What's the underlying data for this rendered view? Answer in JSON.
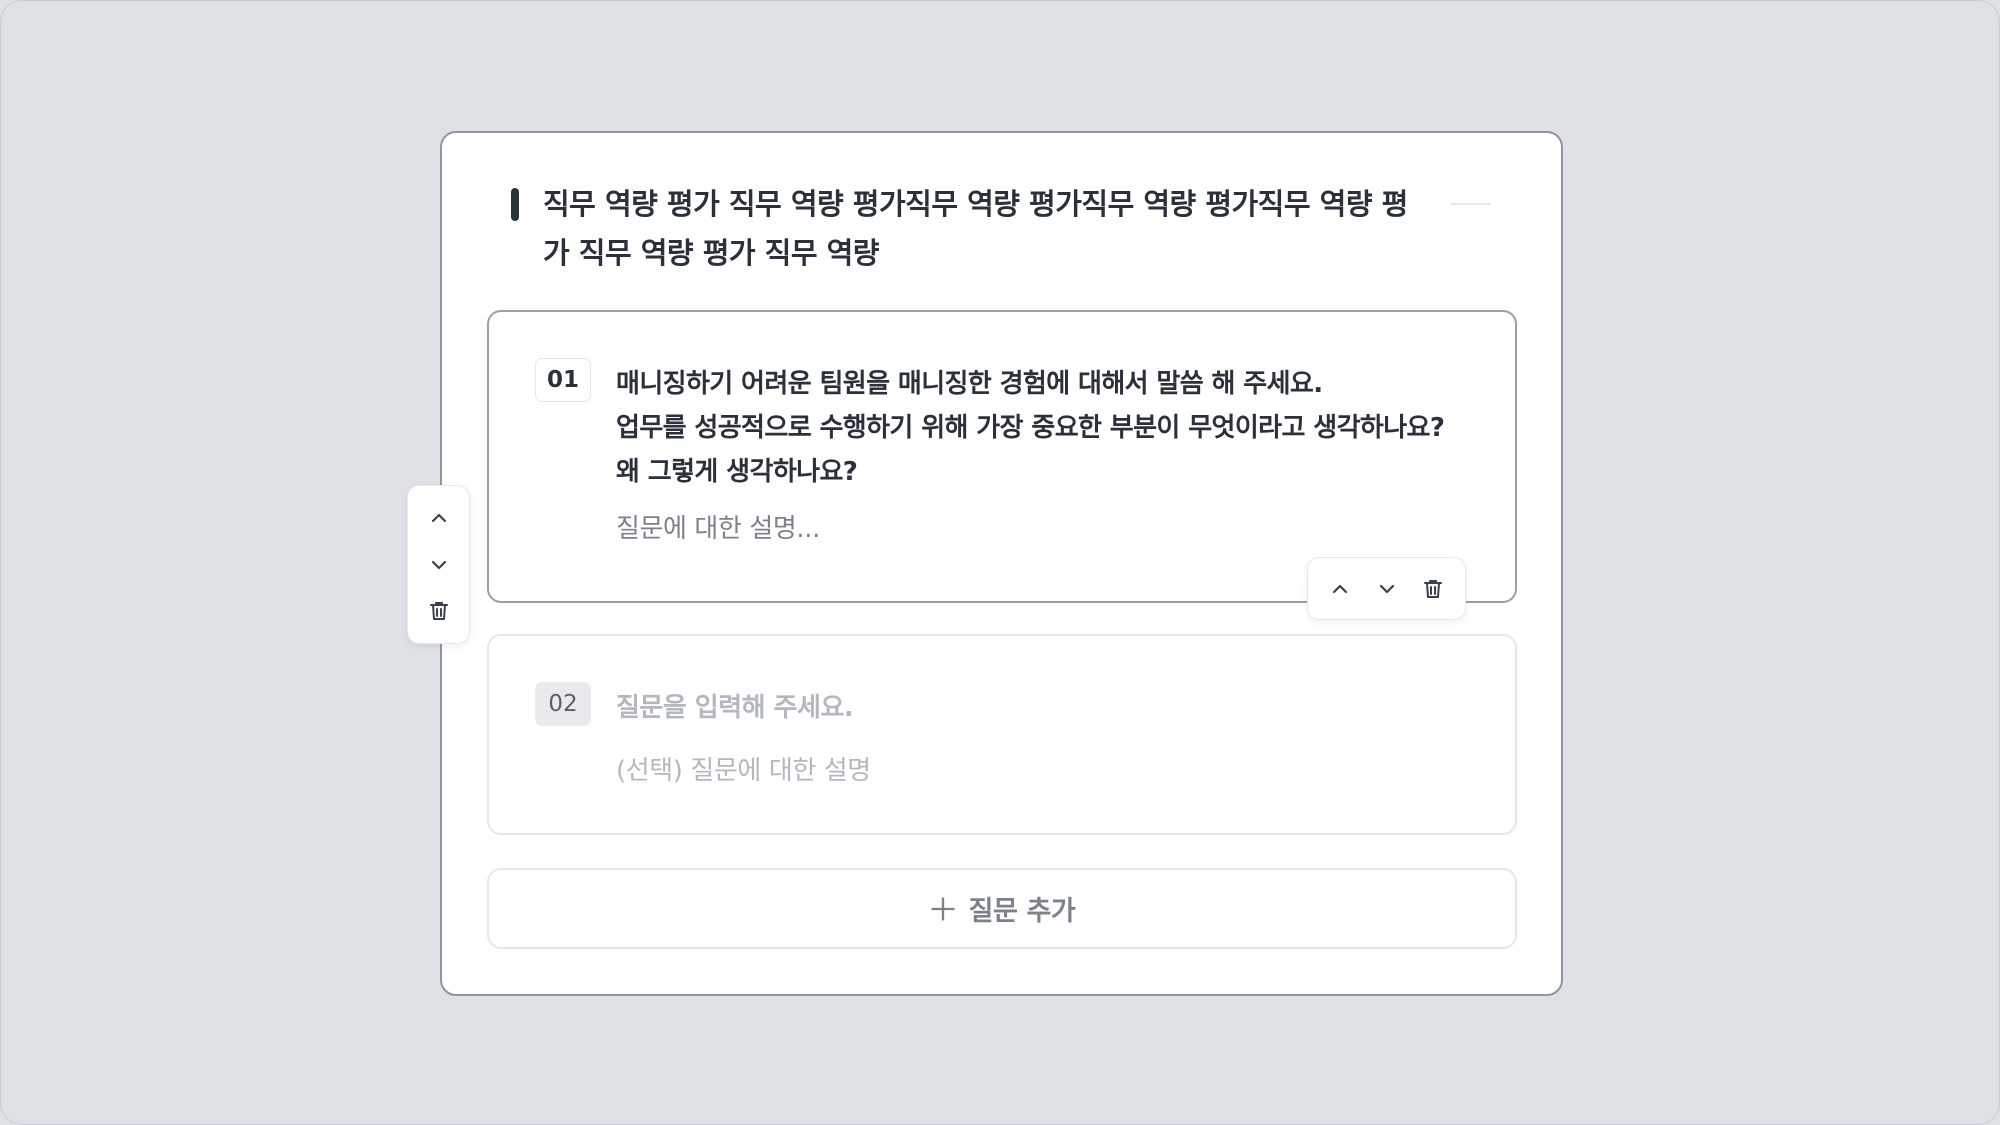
{
  "section": {
    "title": "직무 역량 평가 직무 역량 평가직무 역량 평가직무 역량 평가직무 역량 평가 직무 역량 평가 직무 역량"
  },
  "questions": [
    {
      "number": "01",
      "lines": [
        "매니징하기 어려운 팀원을 매니징한 경험에 대해서 말씀 해 주세요.",
        "업무를 성공적으로 수행하기 위해 가장 중요한 부분이 무엇이라고 생각하나요?",
        "왜 그렇게 생각하나요?"
      ],
      "description": "질문에 대한 설명..."
    },
    {
      "number": "02",
      "placeholder": "질문을 입력해 주세요.",
      "description_placeholder": "(선택) 질문에 대한 설명"
    }
  ],
  "toolbar": {
    "icons": [
      "chevron-up-icon",
      "chevron-down-icon",
      "trash-icon"
    ]
  },
  "add_question": {
    "label": "질문 추가",
    "icon": "plus-icon"
  },
  "colors": {
    "background": "#dee1e6",
    "text_primary": "#2b313b",
    "text_muted": "#7c828c",
    "placeholder": "#b3b8bf"
  }
}
